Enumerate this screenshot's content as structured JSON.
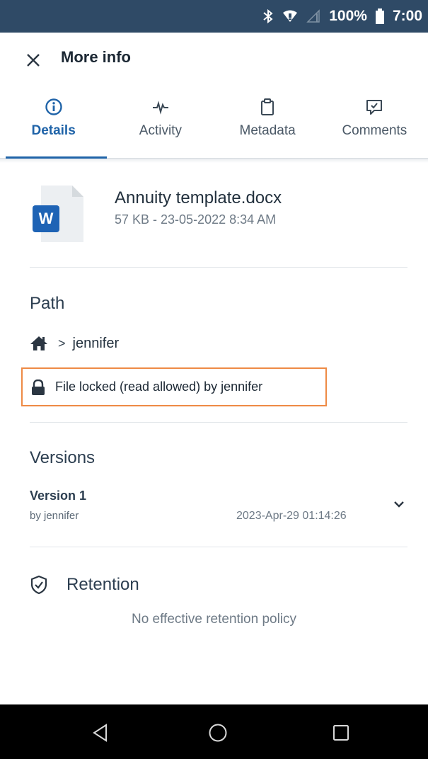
{
  "status_bar": {
    "battery": "100%",
    "time": "7:00",
    "icons": [
      "bluetooth-icon",
      "wifi-icon",
      "signal-icon",
      "battery-icon"
    ]
  },
  "header": {
    "title": "More info",
    "close_icon": "close-icon"
  },
  "tabs": [
    {
      "label": "Details",
      "icon": "info-icon",
      "active": true
    },
    {
      "label": "Activity",
      "icon": "activity-icon",
      "active": false
    },
    {
      "label": "Metadata",
      "icon": "clipboard-icon",
      "active": false
    },
    {
      "label": "Comments",
      "icon": "comment-icon",
      "active": false
    }
  ],
  "file": {
    "name": "Annuity template.docx",
    "meta": "57 KB - 23-05-2022 8:34 AM",
    "icon_letter": "W"
  },
  "path": {
    "heading": "Path",
    "separator": ">",
    "folder": "jennifer"
  },
  "lock": {
    "text": "File locked (read allowed) by jennifer"
  },
  "versions": {
    "heading": "Versions",
    "items": [
      {
        "name": "Version 1",
        "by": "by jennifer",
        "date": "2023-Apr-29 01:14:26"
      }
    ]
  },
  "retention": {
    "heading": "Retention",
    "empty_text": "No effective retention policy"
  },
  "colors": {
    "status_bar": "#2f4a66",
    "accent": "#1f63a8",
    "highlight_border": "#ee8a45",
    "word_blue": "#1e63b5"
  }
}
